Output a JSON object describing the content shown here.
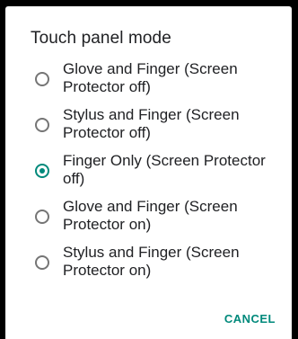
{
  "dialog": {
    "title": "Touch panel mode",
    "options": [
      {
        "label": "Glove and Finger (Screen Protector off)",
        "selected": false
      },
      {
        "label": "Stylus and Finger (Screen Protector off)",
        "selected": false
      },
      {
        "label": "Finger Only (Screen Protector off)",
        "selected": true
      },
      {
        "label": "Glove and Finger (Screen Protector on)",
        "selected": false
      },
      {
        "label": "Stylus and Finger (Screen Protector on)",
        "selected": false
      }
    ],
    "cancel_label": "CANCEL"
  },
  "colors": {
    "accent": "#00897b",
    "radio_off": "#757575",
    "text": "#202124",
    "backdrop": "#000000"
  }
}
